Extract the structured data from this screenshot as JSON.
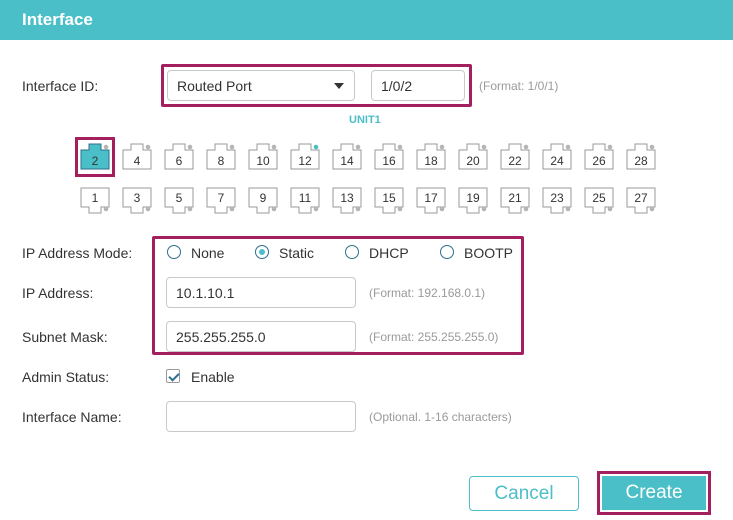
{
  "header": {
    "title": "Interface"
  },
  "interface_id": {
    "label": "Interface ID:",
    "type_value": "Routed Port",
    "port_value": "1/0/2",
    "format_hint": "(Format: 1/0/1)"
  },
  "unit": {
    "label": "UNIT1"
  },
  "ports": {
    "top": [
      "2",
      "4",
      "6",
      "8",
      "10",
      "12",
      "14",
      "16",
      "18",
      "20",
      "22",
      "24",
      "26",
      "28"
    ],
    "bottom": [
      "1",
      "3",
      "5",
      "7",
      "9",
      "11",
      "13",
      "15",
      "17",
      "19",
      "21",
      "23",
      "25",
      "27"
    ],
    "selected": "2",
    "linked": "12"
  },
  "ip_mode": {
    "label": "IP Address Mode:",
    "options": [
      "None",
      "Static",
      "DHCP",
      "BOOTP"
    ],
    "selected": "Static"
  },
  "ip_address": {
    "label": "IP Address:",
    "value": "10.1.10.1",
    "format_hint": "(Format: 192.168.0.1)"
  },
  "subnet_mask": {
    "label": "Subnet Mask:",
    "value": "255.255.255.0",
    "format_hint": "(Format: 255.255.255.0)"
  },
  "admin_status": {
    "label": "Admin Status:",
    "checkbox_label": "Enable",
    "checked": true
  },
  "interface_name": {
    "label": "Interface Name:",
    "value": "",
    "hint": "(Optional. 1-16 characters)"
  },
  "buttons": {
    "cancel": "Cancel",
    "create": "Create"
  },
  "colors": {
    "accent": "#4bbfc7",
    "highlight": "#a41f5e",
    "link_dot": "#4bbfc7"
  }
}
